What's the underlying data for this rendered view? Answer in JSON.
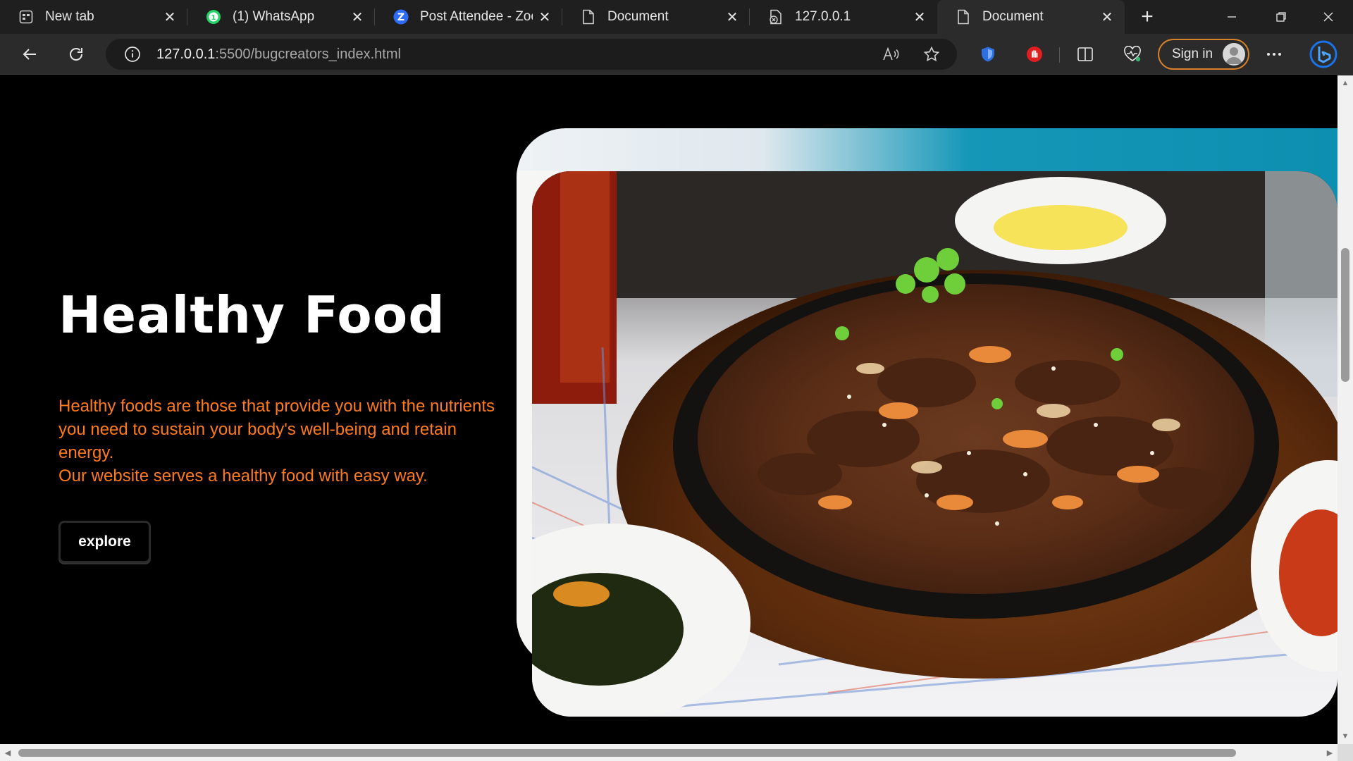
{
  "browser": {
    "tabs": [
      {
        "label": "New tab",
        "icon": "new-tab-page-icon"
      },
      {
        "label": "(1) WhatsApp",
        "icon": "whatsapp-icon",
        "badge": "1"
      },
      {
        "label": "Post Attendee - Zoom",
        "icon": "zoom-icon"
      },
      {
        "label": "Document",
        "icon": "document-icon"
      },
      {
        "label": "127.0.0.1",
        "icon": "file-blocked-icon"
      },
      {
        "label": "Document",
        "icon": "document-icon",
        "active": true
      }
    ],
    "address": {
      "host": "127.0.0.1",
      "path": ":5500/bugcreators_index.html"
    },
    "signin_label": "Sign in",
    "colors": {
      "tabstrip": "#1f1f1f",
      "toolbar": "#2b2b2b",
      "signin_border": "#d9822b",
      "edge_accent": "#1a73e8"
    }
  },
  "page": {
    "hero": {
      "title": "Healthy Food",
      "paragraph_1": "Healthy foods are those that provide you with the nutrients you need to sustain your body's well-being and retain energy.",
      "paragraph_2": "Our website serves a healthy food with easy way.",
      "button_label": "explore"
    },
    "image": {
      "subject": "sizzling-bulgogi-plate-icon"
    },
    "colors": {
      "background": "#000000",
      "title": "#ffffff",
      "text": "#ff7a1a",
      "frame_accent": "#0c8fb0"
    }
  }
}
